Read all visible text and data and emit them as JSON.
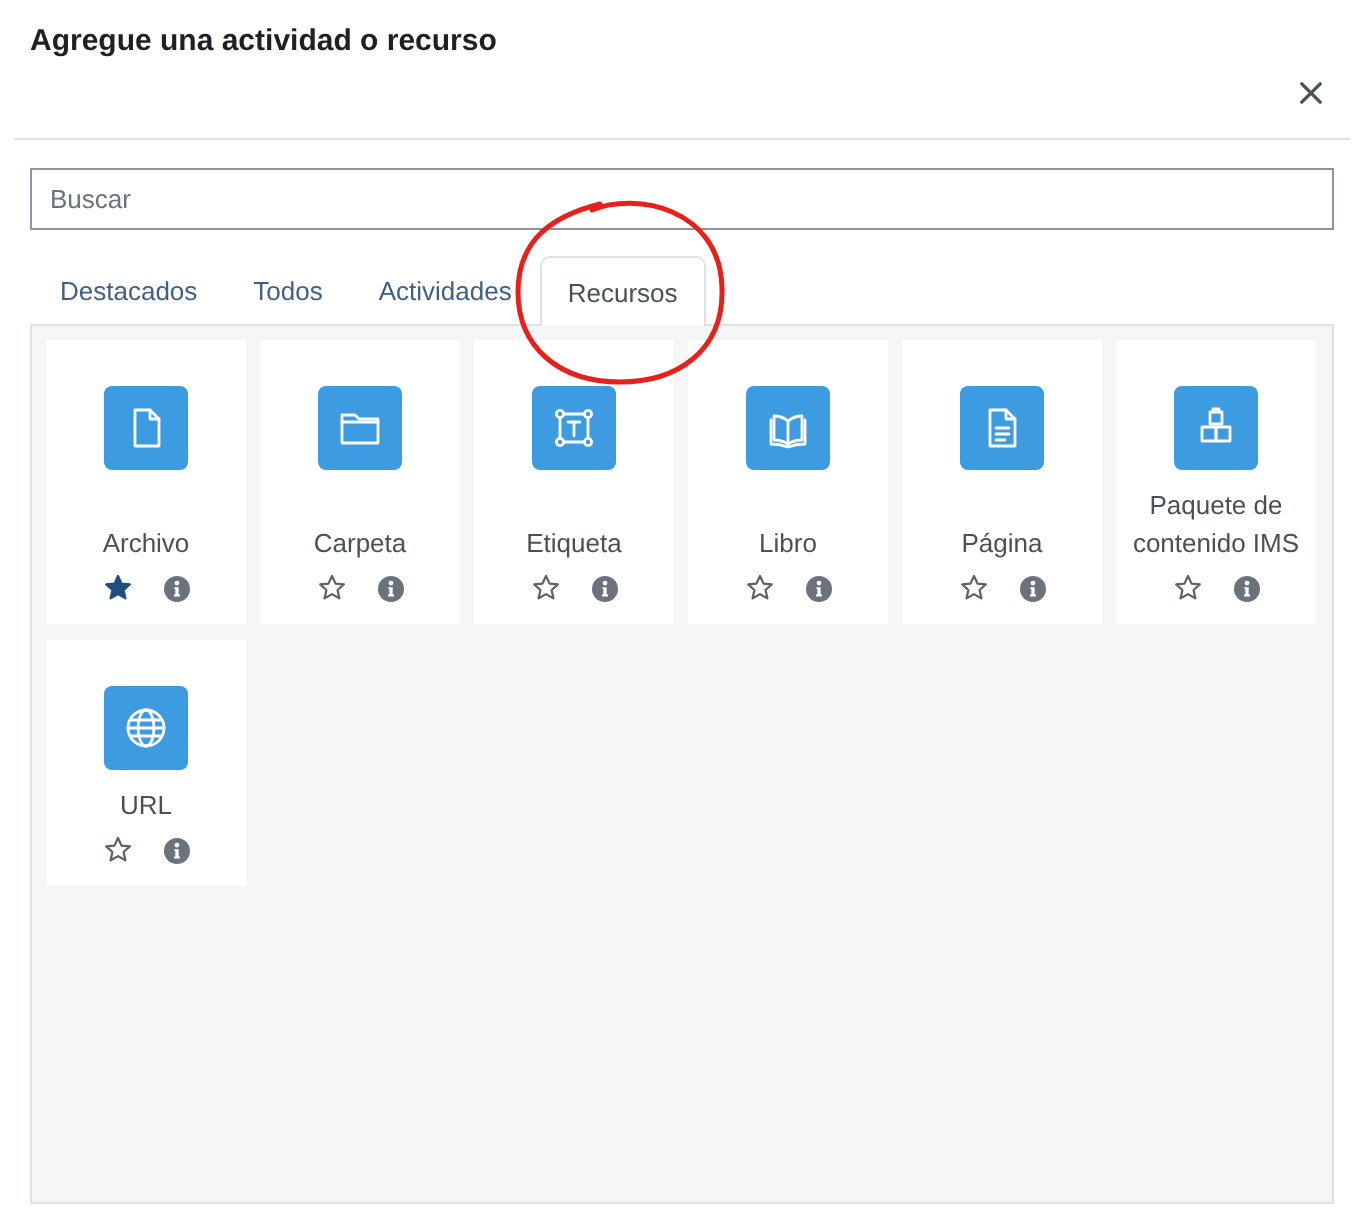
{
  "dialog": {
    "title": "Agregue una actividad o recurso"
  },
  "search": {
    "placeholder": "Buscar"
  },
  "tabs": [
    {
      "label": "Destacados",
      "selected": false,
      "circled": false
    },
    {
      "label": "Todos",
      "selected": false,
      "circled": false
    },
    {
      "label": "Actividades",
      "selected": false,
      "circled": false
    },
    {
      "label": "Recursos",
      "selected": true,
      "circled": true
    }
  ],
  "items": [
    {
      "kind": "file",
      "label": "Archivo",
      "starred": true
    },
    {
      "kind": "folder",
      "label": "Carpeta",
      "starred": false
    },
    {
      "kind": "label",
      "label": "Etiqueta",
      "starred": false
    },
    {
      "kind": "book",
      "label": "Libro",
      "starred": false
    },
    {
      "kind": "page",
      "label": "Página",
      "starred": false
    },
    {
      "kind": "package",
      "label": "Paquete de contenido IMS",
      "starred": false
    },
    {
      "kind": "globe",
      "label": "URL",
      "starred": false
    }
  ]
}
